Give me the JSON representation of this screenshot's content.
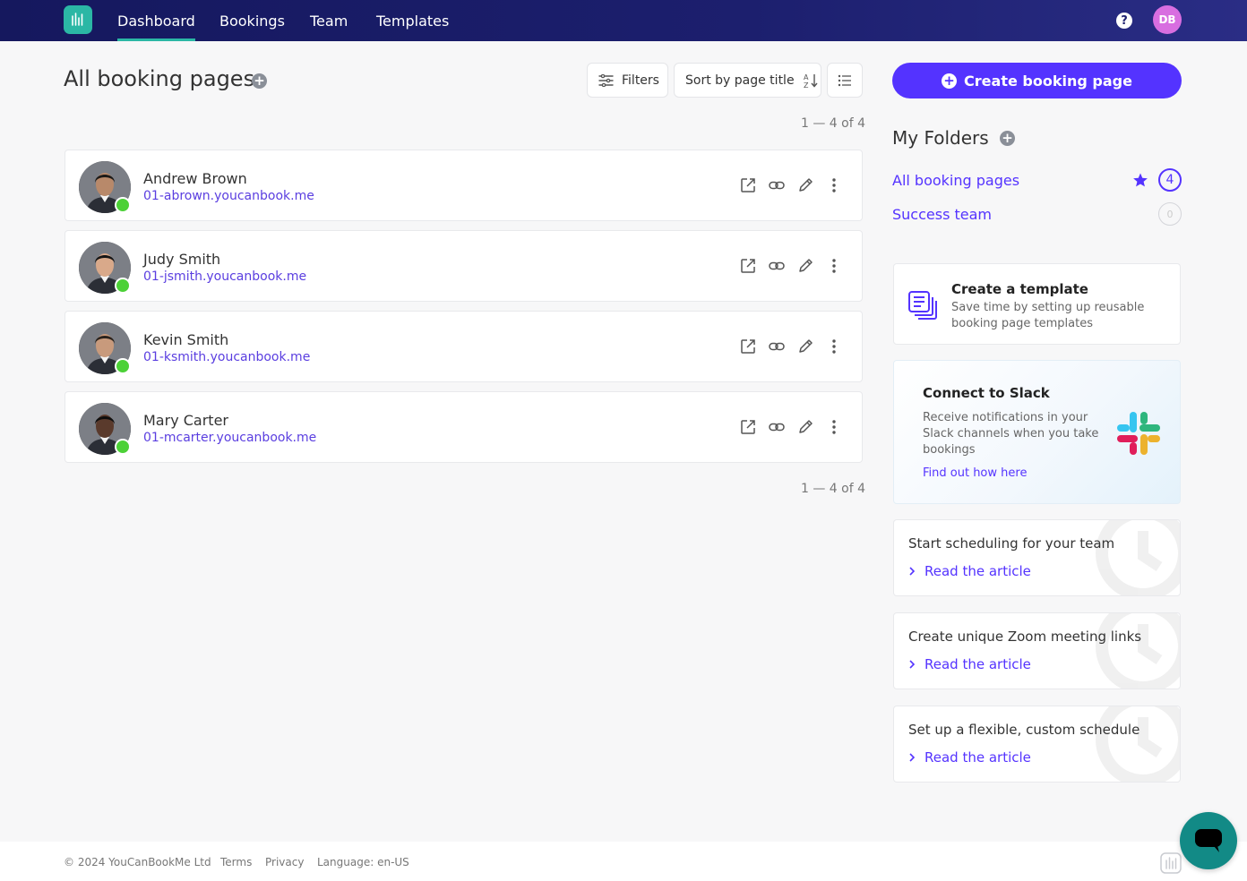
{
  "nav": {
    "tabs": [
      "Dashboard",
      "Bookings",
      "Team",
      "Templates"
    ],
    "active_tab": "Dashboard",
    "user_initials": "DB",
    "help_glyph": "?"
  },
  "header": {
    "title": "All booking pages",
    "filters_label": "Filters",
    "sort_label": "Sort by page title",
    "count_label": "1 — 4 of 4"
  },
  "pages": [
    {
      "name": "Andrew Brown",
      "url": "01-abrown.youcanbook.me"
    },
    {
      "name": "Judy Smith",
      "url": "01-jsmith.youcanbook.me"
    },
    {
      "name": "Kevin Smith",
      "url": "01-ksmith.youcanbook.me"
    },
    {
      "name": "Mary Carter",
      "url": "01-mcarter.youcanbook.me"
    }
  ],
  "sidebar": {
    "create_label": "Create booking page",
    "folders_title": "My Folders",
    "folders": [
      {
        "label": "All booking pages",
        "count": "4"
      },
      {
        "label": "Success team",
        "count": "0"
      }
    ],
    "template_card": {
      "title": "Create a template",
      "description": "Save time by setting up reusable booking page templates"
    },
    "slack_card": {
      "title": "Connect to Slack",
      "description": "Receive notifications in your Slack channels when you take bookings",
      "link": "Find out how here"
    },
    "articles": [
      {
        "title": "Start scheduling for your team",
        "link": "Read the article"
      },
      {
        "title": "Create unique Zoom meeting links",
        "link": "Read the article"
      },
      {
        "title": "Set up a flexible, custom schedule",
        "link": "Read the article"
      }
    ]
  },
  "footer": {
    "copyright": "© 2024 YouCanBookMe Ltd",
    "terms": "Terms",
    "privacy": "Privacy",
    "language": "Language: en-US"
  },
  "colors": {
    "nav_bg": "#1c1f6e",
    "accent": "#5433ff",
    "brand_teal": "#2bb7a5",
    "status_online": "#4cd137"
  }
}
